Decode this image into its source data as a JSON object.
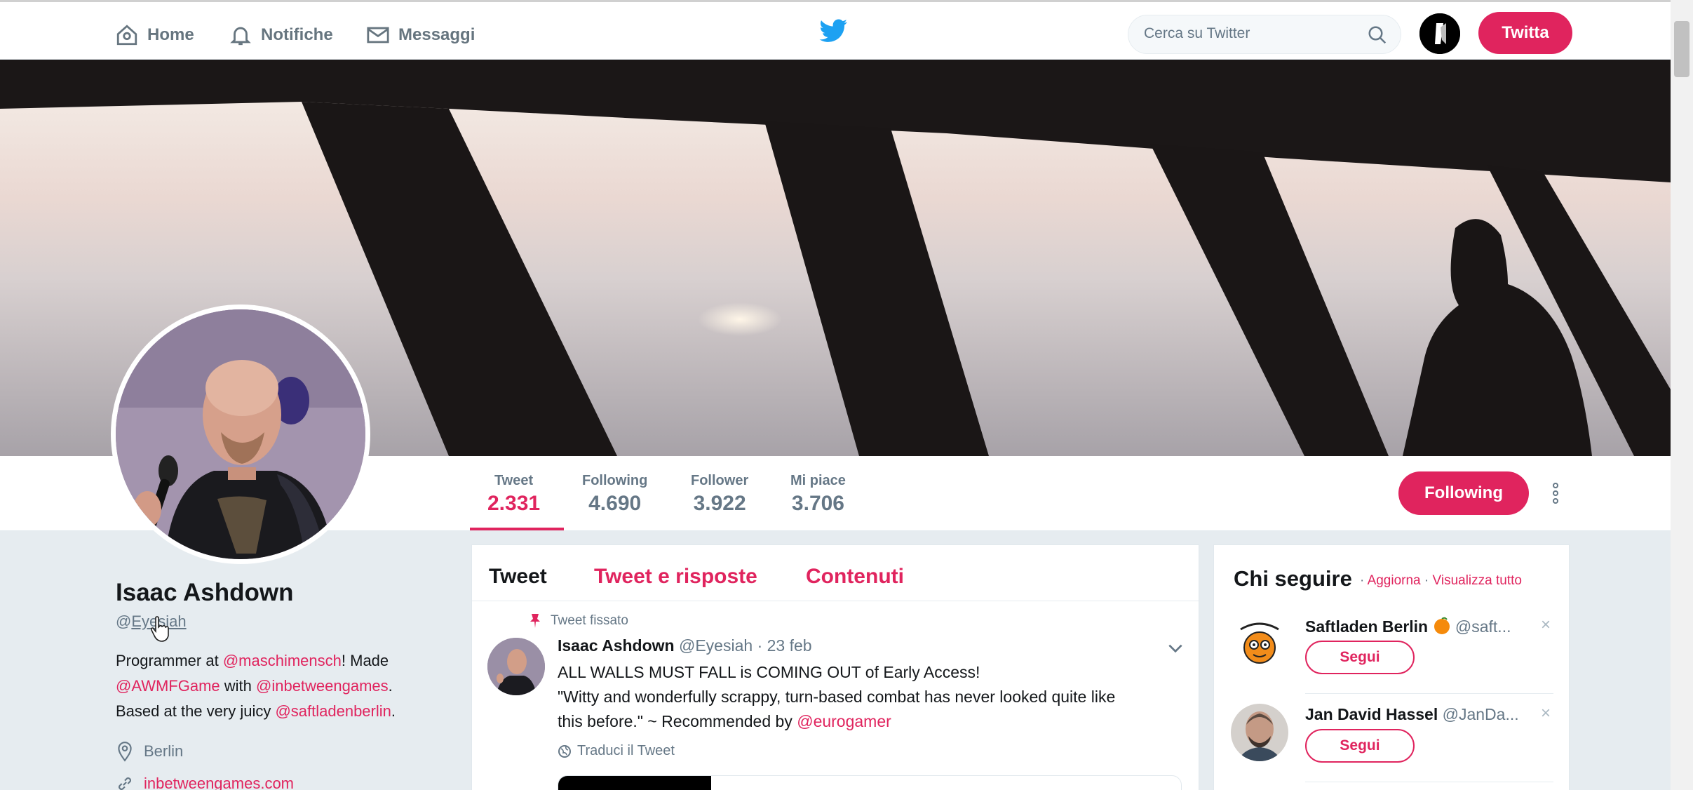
{
  "nav": {
    "home": "Home",
    "notifications": "Notifiche",
    "messages": "Messaggi",
    "search_placeholder": "Cerca su Twitter",
    "tweet_button": "Twitta"
  },
  "stats": [
    {
      "label": "Tweet",
      "value": "2.331"
    },
    {
      "label": "Following",
      "value": "4.690"
    },
    {
      "label": "Follower",
      "value": "3.922"
    },
    {
      "label": "Mi piace",
      "value": "3.706"
    }
  ],
  "follow_button": "Following",
  "profile": {
    "name": "Isaac Ashdown",
    "handle_prefix": "@",
    "handle": "Eyesiah",
    "bio": {
      "l1a": "Programmer at ",
      "l1m": "@maschimensch",
      "l1b": "! Made",
      "l2m1": "@AWMFGame",
      "l2a": " with ",
      "l2m2": "@inbetweengames",
      "l2b": ".",
      "l3a": "Based at the very juicy ",
      "l3m": "@saftladenberlin",
      "l3b": "."
    },
    "location": "Berlin",
    "website": "inbetweengames.com"
  },
  "timeline": {
    "tabs": [
      "Tweet",
      "Tweet e risposte",
      "Contenuti"
    ],
    "pinned_label": "Tweet fissato",
    "tweet": {
      "name": "Isaac Ashdown",
      "handle": "@Eyesiah",
      "date": "· 23 feb",
      "line1": "ALL WALLS MUST FALL is COMING OUT of Early Access!",
      "line2": "\"Witty and wonderfully scrappy, turn-based combat has never looked quite like",
      "line3a": "this before.\" ~ Recommended by ",
      "line3m": "@eurogamer",
      "translate": "Traduci il Tweet"
    }
  },
  "who_to_follow": {
    "title": "Chi seguire",
    "refresh": "Aggiorna",
    "view_all": "Visualizza tutto",
    "sep": " · ",
    "suggestions": [
      {
        "name": "Saftladen Berlin",
        "handle": "@saft...",
        "button": "Segui",
        "close": "×"
      },
      {
        "name": "Jan David Hassel",
        "handle": "@JanDa...",
        "button": "Segui",
        "close": "×"
      }
    ]
  },
  "colors": {
    "accent": "#e0245e",
    "twitter_blue": "#1da1f2",
    "muted": "#657786"
  }
}
